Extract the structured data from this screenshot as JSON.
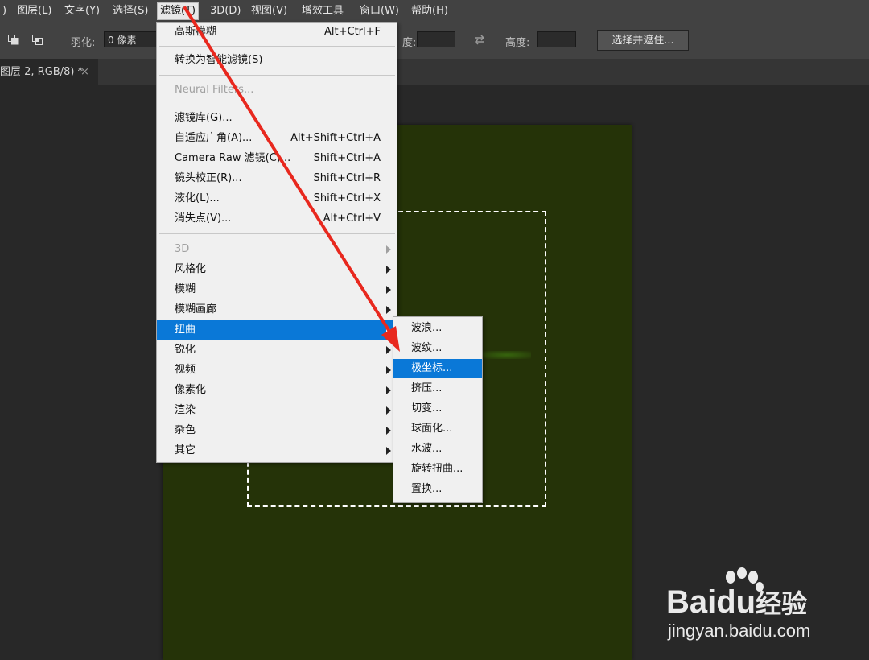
{
  "menubar": {
    "items": [
      {
        "label": ")"
      },
      {
        "label": "图层(L)"
      },
      {
        "label": "文字(Y)"
      },
      {
        "label": "选择(S)"
      },
      {
        "label": "滤镜(T)"
      },
      {
        "label": "3D(D)"
      },
      {
        "label": "视图(V)"
      },
      {
        "label": "增效工具"
      },
      {
        "label": "窗口(W)"
      },
      {
        "label": "帮助(H)"
      }
    ]
  },
  "options": {
    "feather_label": "羽化:",
    "feather_value": "0 像素",
    "width_label": "度:",
    "height_label": "高度:",
    "select_mask_button": "选择并遮住..."
  },
  "tab": {
    "title": "图层 2, RGB/8) *",
    "close": "×"
  },
  "filter_menu": {
    "items": [
      {
        "label": "高斯模糊",
        "shortcut": "Alt+Ctrl+F"
      },
      {
        "label": "转换为智能滤镜(S)",
        "shortcut": ""
      },
      {
        "label": "Neural Filters...",
        "shortcut": ""
      },
      {
        "label": "滤镜库(G)...",
        "shortcut": ""
      },
      {
        "label": "自适应广角(A)...",
        "shortcut": "Alt+Shift+Ctrl+A"
      },
      {
        "label": "Camera Raw 滤镜(C)...",
        "shortcut": "Shift+Ctrl+A"
      },
      {
        "label": "镜头校正(R)...",
        "shortcut": "Shift+Ctrl+R"
      },
      {
        "label": "液化(L)...",
        "shortcut": "Shift+Ctrl+X"
      },
      {
        "label": "消失点(V)...",
        "shortcut": "Alt+Ctrl+V"
      },
      {
        "label": "3D",
        "shortcut": ""
      },
      {
        "label": "风格化",
        "shortcut": ""
      },
      {
        "label": "模糊",
        "shortcut": ""
      },
      {
        "label": "模糊画廊",
        "shortcut": ""
      },
      {
        "label": "扭曲",
        "shortcut": ""
      },
      {
        "label": "锐化",
        "shortcut": ""
      },
      {
        "label": "视频",
        "shortcut": ""
      },
      {
        "label": "像素化",
        "shortcut": ""
      },
      {
        "label": "渲染",
        "shortcut": ""
      },
      {
        "label": "杂色",
        "shortcut": ""
      },
      {
        "label": "其它",
        "shortcut": ""
      }
    ]
  },
  "distort_submenu": {
    "items": [
      {
        "label": "波浪..."
      },
      {
        "label": "波纹..."
      },
      {
        "label": "极坐标..."
      },
      {
        "label": "挤压..."
      },
      {
        "label": "切变..."
      },
      {
        "label": "球面化..."
      },
      {
        "label": "水波..."
      },
      {
        "label": "旋转扭曲..."
      },
      {
        "label": "置换..."
      }
    ]
  },
  "watermark": {
    "logo": "Bai",
    "logo_suffix": "du",
    "logo_cn": "经验",
    "url": "jingyan.baidu.com"
  },
  "colors": {
    "highlight": "#0a78d7",
    "arrow": "#e8281e",
    "canvas": "#253308"
  }
}
